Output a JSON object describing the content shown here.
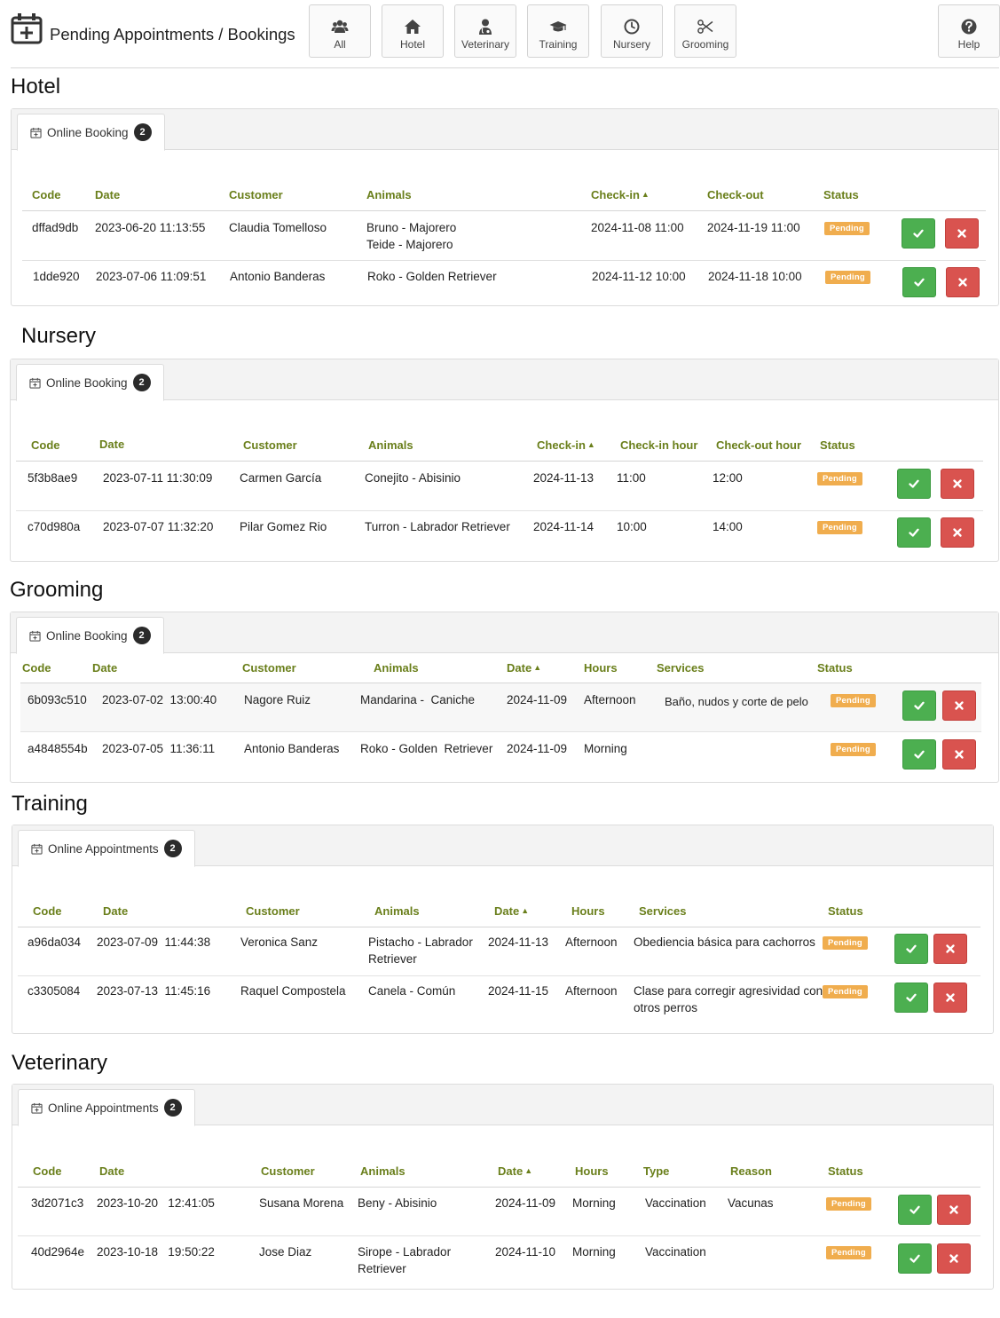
{
  "header": {
    "title": "Pending Appointments / Bookings",
    "nav": [
      {
        "label": "All",
        "icon": "users-icon"
      },
      {
        "label": "Hotel",
        "icon": "home-icon"
      },
      {
        "label": "Veterinary",
        "icon": "doctor-icon"
      },
      {
        "label": "Training",
        "icon": "graduation-cap-icon"
      },
      {
        "label": "Nursery",
        "icon": "clock-icon"
      },
      {
        "label": "Grooming",
        "icon": "scissors-icon"
      },
      {
        "label": "Help",
        "icon": "question-icon"
      }
    ]
  },
  "colors": {
    "header_text": "#6a7f1b",
    "pending": "#f0ad4e",
    "approve": "#4caf50",
    "reject": "#d9534f"
  },
  "status_label": "Pending",
  "hotel": {
    "title": "Hotel",
    "tab": {
      "label": "Online Booking",
      "count": "2"
    },
    "columns": [
      "Code",
      "Date",
      "Customer",
      "Animals",
      "Check-in",
      "Check-out",
      "Status"
    ],
    "rows": [
      {
        "code": "dffad9db",
        "date": "2023-06-20 11:13:55",
        "customer": "Claudia Tomelloso",
        "animals": [
          "Bruno - Majorero",
          "Teide - Majorero"
        ],
        "checkin": "2024-11-08 11:00",
        "checkout": "2024-11-19 11:00"
      },
      {
        "code": "1dde920",
        "date": "2023-07-06 11:09:51",
        "customer": "Antonio Banderas",
        "animals": [
          "Roko - Golden Retriever"
        ],
        "checkin": "2024-11-12 10:00",
        "checkout": "2024-11-18 10:00"
      }
    ]
  },
  "nursery": {
    "title": "Nursery",
    "tab": {
      "label": "Online Booking",
      "count": "2"
    },
    "columns": [
      "Code",
      "Date",
      "Customer",
      "Animals",
      "Check-in",
      "Check-in hour",
      "Check-out hour",
      "Status"
    ],
    "rows": [
      {
        "code": "5f3b8ae9",
        "date": "2023-07-11 11:30:09",
        "customer": "Carmen García",
        "animals": "Conejito - Abisinio",
        "checkin": "2024-11-13",
        "checkin_hour": "11:00",
        "checkout_hour": "12:00"
      },
      {
        "code": "c70d980a",
        "date": "2023-07-07 11:32:20",
        "customer": "Pilar Gomez Rio",
        "animals": "Turron - Labrador Retriever",
        "checkin": "2024-11-14",
        "checkin_hour": "10:00",
        "checkout_hour": "14:00"
      }
    ]
  },
  "grooming": {
    "title": "Grooming",
    "tab": {
      "label": "Online Booking",
      "count": "2"
    },
    "columns": [
      "Code",
      "Date",
      "Customer",
      "Animals",
      "Date",
      "Hours",
      "Services",
      "Status"
    ],
    "rows": [
      {
        "code": "6b093c510",
        "date": "2023-07-02  13:00:40",
        "customer": "Nagore Ruiz",
        "animals": "Mandarina -  Caniche",
        "appt_date": "2024-11-09",
        "hours": "Afternoon",
        "services": "Baño, nudos y corte de pelo"
      },
      {
        "code": "a4848554b",
        "date": "2023-07-05  11:36:11",
        "customer": "Antonio Banderas",
        "animals": "Roko - Golden  Retriever",
        "appt_date": "2024-11-09",
        "hours": "Morning",
        "services": ""
      }
    ]
  },
  "training": {
    "title": "Training",
    "tab": {
      "label": "Online Appointments",
      "count": "2"
    },
    "columns": [
      "Code",
      "Date",
      "Customer",
      "Animals",
      "Date",
      "Hours",
      "Services",
      "Status"
    ],
    "rows": [
      {
        "code": "a96da034",
        "date": "2023-07-09  11:44:38",
        "customer": "Veronica Sanz",
        "animals": [
          "Pistacho - Labrador",
          "Retriever"
        ],
        "appt_date": "2024-11-13",
        "hours": "Afternoon",
        "services": [
          "Obediencia básica para cachorros"
        ]
      },
      {
        "code": "c3305084",
        "date": "2023-07-13  11:45:16",
        "customer": "Raquel Compostela",
        "animals": [
          "Canela - Común"
        ],
        "appt_date": "2024-11-15",
        "hours": "Afternoon",
        "services": [
          "Clase para corregir agresividad con",
          "otros perros"
        ]
      }
    ]
  },
  "veterinary": {
    "title": "Veterinary",
    "tab": {
      "label": "Online Appointments",
      "count": "2"
    },
    "columns": [
      "Code",
      "Date",
      "Customer",
      "Animals",
      "Date",
      "Hours",
      "Type",
      "Reason",
      "Status"
    ],
    "rows": [
      {
        "code": "3d2071c3",
        "date": "2023-10-20   12:41:05",
        "customer": "Susana Morena",
        "animals": [
          "Beny - Abisinio"
        ],
        "appt_date": "2024-11-09",
        "hours": "Morning",
        "type": "Vaccination",
        "reason": "Vacunas"
      },
      {
        "code": "40d2964e",
        "date": "2023-10-18   19:50:22",
        "customer": "Jose Diaz",
        "animals": [
          "Sirope - Labrador",
          "Retriever"
        ],
        "appt_date": "2024-11-10",
        "hours": "Morning",
        "type": "Vaccination",
        "reason": ""
      }
    ]
  }
}
